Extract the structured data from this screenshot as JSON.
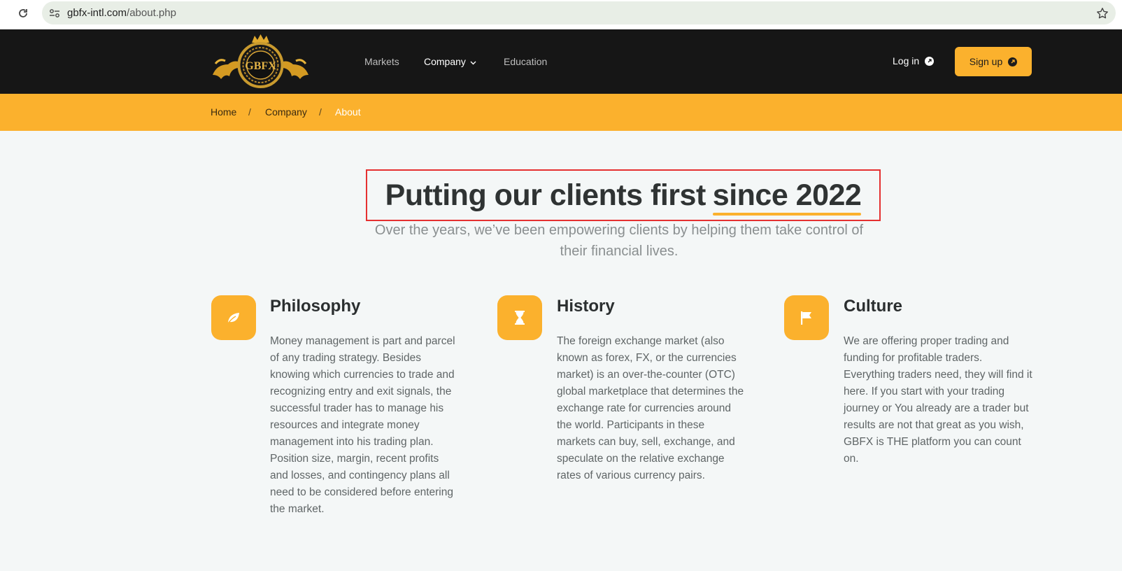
{
  "browser": {
    "url_host": "gbfx-intl.com",
    "url_path": "/about.php"
  },
  "header": {
    "logo_text": "GBFX",
    "nav": [
      {
        "label": "Markets"
      },
      {
        "label": "Company"
      },
      {
        "label": "Education"
      }
    ],
    "login_label": "Log in",
    "signup_label": "Sign up"
  },
  "breadcrumb": {
    "items": [
      "Home",
      "Company",
      "About"
    ],
    "separator": "/"
  },
  "hero": {
    "title_main": "Putting our clients first",
    "title_highlight": "since 2022",
    "subtitle": "Over the years, we’ve been empowering clients by helping them take control of their financial lives."
  },
  "features": [
    {
      "icon": "leaf-icon",
      "title": "Philosophy",
      "text": "Money management is part and parcel of any trading strategy. Besides knowing which currencies to trade and recognizing entry and exit signals, the successful trader has to manage his resources and integrate money management into his trading plan. Position size, margin, recent profits and losses, and contingency plans all need to be considered before entering the market."
    },
    {
      "icon": "hourglass-icon",
      "title": "History",
      "text": "The foreign exchange market (also known as forex, FX, or the currencies market) is an over-the-counter (OTC) global marketplace that determines the exchange rate for currencies around the world. Participants in these markets can buy, sell, exchange, and speculate on the relative exchange rates of various currency pairs."
    },
    {
      "icon": "flag-icon",
      "title": "Culture",
      "text": "We are offering proper trading and funding for profitable traders. Everything traders need, they will find it here. If you start with your trading journey or You already are a trader but results are not that great as you wish, GBFX is THE platform you can count on."
    }
  ],
  "colors": {
    "accent": "#fbb12d",
    "header_bg": "#161616",
    "page_bg": "#f4f7f7",
    "highlight_box": "#e53030"
  }
}
